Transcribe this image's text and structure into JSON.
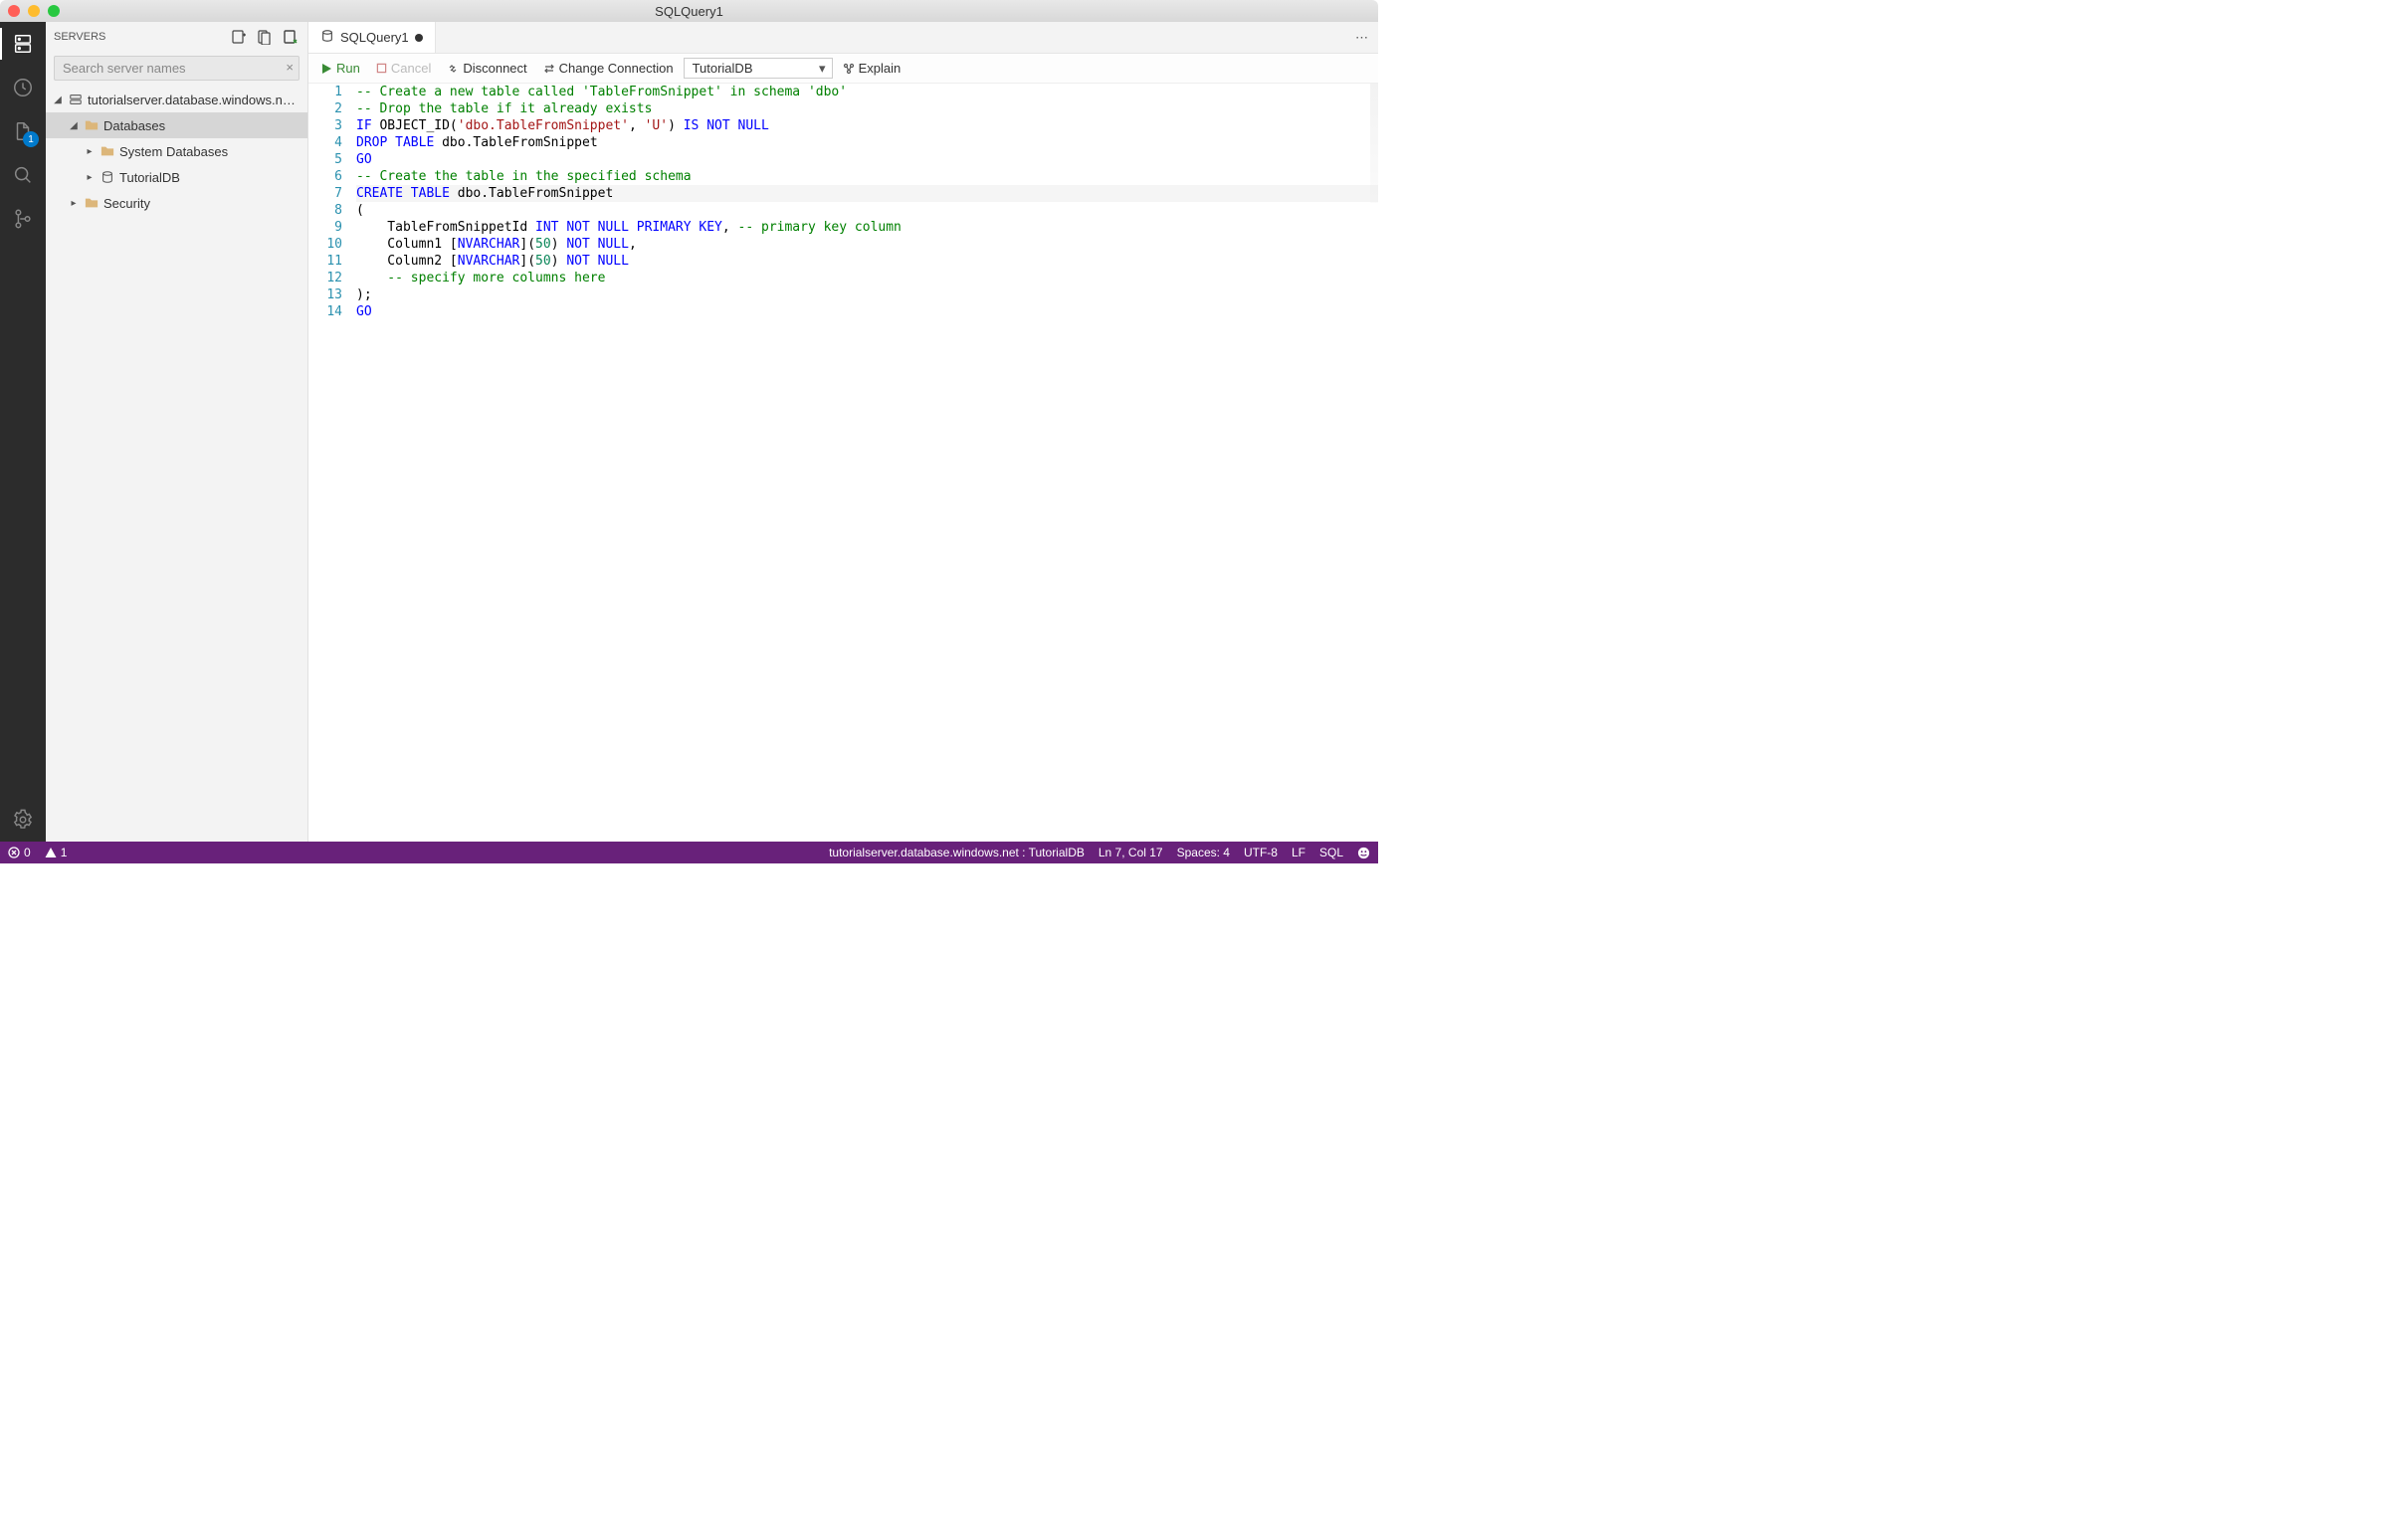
{
  "window": {
    "title": "SQLQuery1"
  },
  "activity": {
    "items": [
      {
        "name": "servers-activity-icon",
        "active": true
      },
      {
        "name": "task-history-activity-icon",
        "active": false
      },
      {
        "name": "explorer-activity-icon",
        "active": false,
        "badge": "1"
      },
      {
        "name": "search-activity-icon",
        "active": false
      },
      {
        "name": "source-control-activity-icon",
        "active": false
      }
    ],
    "bottom": [
      {
        "name": "settings-gear-icon"
      }
    ]
  },
  "sidebar": {
    "title": "SERVERS",
    "searchPlaceholder": "Search server names",
    "tree": {
      "server": "tutorialserver.database.windows.n…",
      "nodes": {
        "databases": "Databases",
        "systemDatabases": "System Databases",
        "tutorialdb": "TutorialDB",
        "security": "Security"
      }
    }
  },
  "tabs": {
    "items": [
      {
        "label": "SQLQuery1",
        "dirty": true
      }
    ]
  },
  "toolbar": {
    "run": "Run",
    "cancel": "Cancel",
    "disconnect": "Disconnect",
    "changeConnection": "Change Connection",
    "databaseSelected": "TutorialDB",
    "explain": "Explain"
  },
  "editor": {
    "lineCount": 14,
    "lines": [
      {
        "n": 1,
        "tokens": [
          {
            "t": "-- Create a new table called 'TableFromSnippet' in schema 'dbo'",
            "c": "c-comment"
          }
        ]
      },
      {
        "n": 2,
        "tokens": [
          {
            "t": "-- Drop the table if it already exists",
            "c": "c-comment"
          }
        ]
      },
      {
        "n": 3,
        "tokens": [
          {
            "t": "IF",
            "c": "c-kw"
          },
          {
            "t": " OBJECT_ID(",
            "c": "c-ident"
          },
          {
            "t": "'dbo.TableFromSnippet'",
            "c": "c-str"
          },
          {
            "t": ", ",
            "c": "c-ident"
          },
          {
            "t": "'U'",
            "c": "c-str"
          },
          {
            "t": ") ",
            "c": "c-ident"
          },
          {
            "t": "IS NOT NULL",
            "c": "c-kw"
          }
        ]
      },
      {
        "n": 4,
        "tokens": [
          {
            "t": "DROP TABLE",
            "c": "c-kw"
          },
          {
            "t": " dbo.TableFromSnippet",
            "c": "c-ident"
          }
        ]
      },
      {
        "n": 5,
        "tokens": [
          {
            "t": "GO",
            "c": "c-kw"
          }
        ]
      },
      {
        "n": 6,
        "tokens": [
          {
            "t": "-- Create the table in the specified schema",
            "c": "c-comment"
          }
        ]
      },
      {
        "n": 7,
        "current": true,
        "tokens": [
          {
            "t": "CREATE TABLE",
            "c": "c-kw"
          },
          {
            "t": " dbo.TableFromSnippet",
            "c": "c-ident"
          }
        ]
      },
      {
        "n": 8,
        "tokens": [
          {
            "t": "(",
            "c": "c-ident"
          }
        ]
      },
      {
        "n": 9,
        "tokens": [
          {
            "t": "    TableFromSnippetId ",
            "c": "c-ident"
          },
          {
            "t": "INT NOT NULL PRIMARY KEY",
            "c": "c-kw"
          },
          {
            "t": ", ",
            "c": "c-ident"
          },
          {
            "t": "-- primary key column",
            "c": "c-comment"
          }
        ]
      },
      {
        "n": 10,
        "tokens": [
          {
            "t": "    Column1 [",
            "c": "c-ident"
          },
          {
            "t": "NVARCHAR",
            "c": "c-kw"
          },
          {
            "t": "](",
            "c": "c-ident"
          },
          {
            "t": "50",
            "c": "c-num"
          },
          {
            "t": ") ",
            "c": "c-ident"
          },
          {
            "t": "NOT NULL",
            "c": "c-kw"
          },
          {
            "t": ",",
            "c": "c-ident"
          }
        ]
      },
      {
        "n": 11,
        "tokens": [
          {
            "t": "    Column2 [",
            "c": "c-ident"
          },
          {
            "t": "NVARCHAR",
            "c": "c-kw"
          },
          {
            "t": "](",
            "c": "c-ident"
          },
          {
            "t": "50",
            "c": "c-num"
          },
          {
            "t": ") ",
            "c": "c-ident"
          },
          {
            "t": "NOT NULL",
            "c": "c-kw"
          }
        ]
      },
      {
        "n": 12,
        "tokens": [
          {
            "t": "    -- specify more columns here",
            "c": "c-comment"
          }
        ]
      },
      {
        "n": 13,
        "tokens": [
          {
            "t": ");",
            "c": "c-ident"
          }
        ]
      },
      {
        "n": 14,
        "tokens": [
          {
            "t": "GO",
            "c": "c-kw"
          }
        ]
      }
    ]
  },
  "status": {
    "errors": "0",
    "warnings": "1",
    "connection": "tutorialserver.database.windows.net : TutorialDB",
    "lineCol": "Ln 7, Col 17",
    "spaces": "Spaces: 4",
    "encoding": "UTF-8",
    "eol": "LF",
    "language": "SQL"
  }
}
